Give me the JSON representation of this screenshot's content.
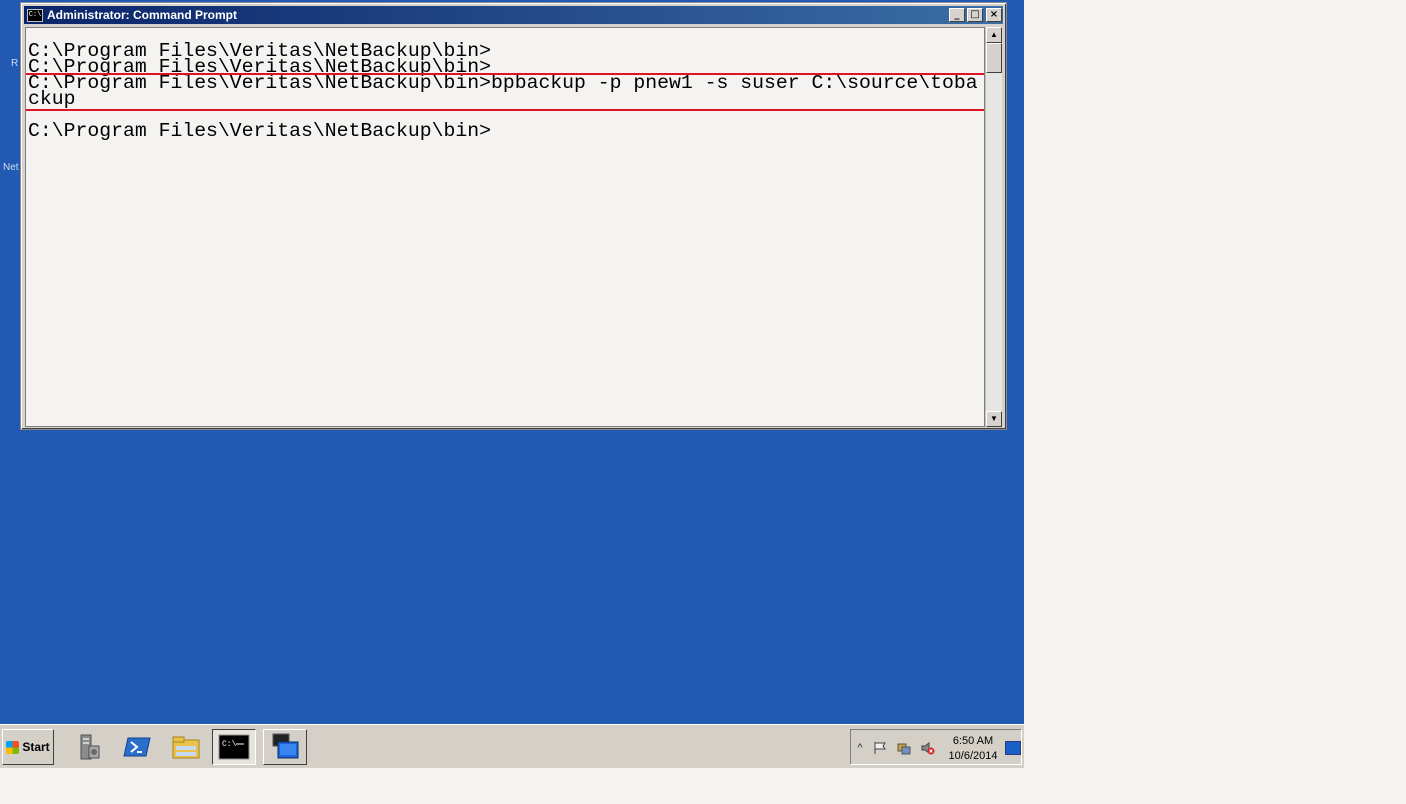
{
  "desktop": {
    "partial_icon_labels": [
      "R",
      "Net"
    ]
  },
  "window": {
    "title": "Administrator: Command Prompt",
    "icon": "cmd-icon",
    "icon_text": "C:\\",
    "minimize_glyph": "_",
    "maximize_glyph": "□",
    "close_glyph": "×"
  },
  "console": {
    "lines": [
      "C:\\Program Files\\Veritas\\NetBackup\\bin>",
      "C:\\Program Files\\Veritas\\NetBackup\\bin>",
      "C:\\Program Files\\Veritas\\NetBackup\\bin>bpbackup -p pnew1 -s suser C:\\source\\toba",
      "ckup",
      "",
      "C:\\Program Files\\Veritas\\NetBackup\\bin>"
    ],
    "highlight_color": "#e0141e"
  },
  "scrollbar": {
    "up_glyph": "▲",
    "down_glyph": "▼"
  },
  "taskbar": {
    "start_label": "Start",
    "pinned": [
      {
        "name": "server-manager-icon"
      },
      {
        "name": "powershell-icon"
      },
      {
        "name": "file-explorer-icon"
      },
      {
        "name": "command-prompt-icon"
      },
      {
        "name": "remote-desktop-icon"
      }
    ],
    "tray": {
      "expand_glyph": "^",
      "icons": [
        "flag-icon",
        "network-icon",
        "volume-muted-icon"
      ],
      "time": "6:50 AM",
      "date": "10/6/2014"
    }
  },
  "colors": {
    "desktop": "#2259b3",
    "console_bg": "#f4f3f1",
    "titlebar_start": "#0a246a",
    "titlebar_end": "#3a6ea5"
  }
}
